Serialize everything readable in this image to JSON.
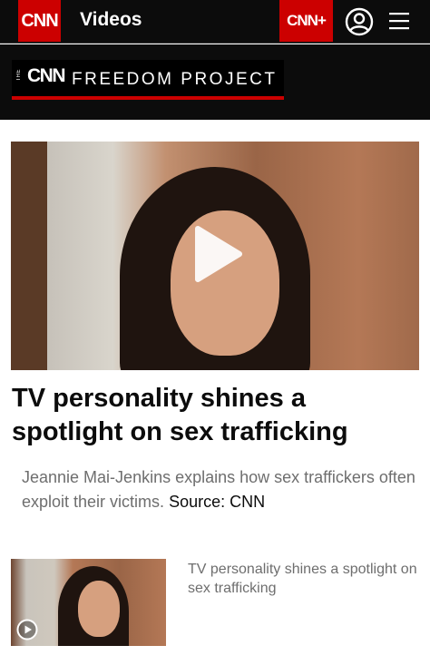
{
  "nav": {
    "logo": "CNN",
    "section": "Videos",
    "plus_logo": "CNN+",
    "account_icon": "account-icon",
    "menu_icon": "hamburger-menu-icon"
  },
  "banner": {
    "the": "THE",
    "cnn": "CNN",
    "title": "FREEDOM PROJECT"
  },
  "hero": {
    "play_icon": "play-icon",
    "headline": "TV personality shines a spotlight on sex trafficking",
    "description": "Jeannie Mai-Jenkins explains how sex traffickers often exploit their victims.",
    "source": "Source: CNN"
  },
  "related": [
    {
      "title": "TV personality shines a spotlight on sex trafficking",
      "play_icon": "play-circle-icon"
    }
  ],
  "colors": {
    "brand_red": "#cc0000",
    "nav_bg": "#0c0c0c",
    "muted_text": "#6e6e6e"
  }
}
